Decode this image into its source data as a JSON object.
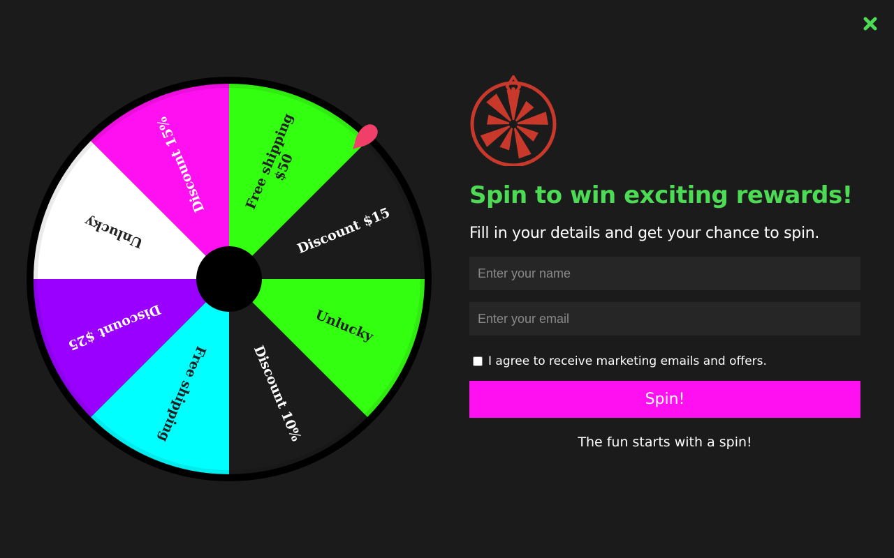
{
  "popup": {
    "close_label": "✖",
    "headline": "Spin to win exciting rewards!",
    "subheadline": "Fill in your details and get your chance to spin.",
    "name_placeholder": "Enter your name",
    "email_placeholder": "Enter your email",
    "consent_label": "I agree to receive marketing emails and offers.",
    "spin_label": "Spin!",
    "tagline": "The fun starts with a spin!"
  },
  "wheel": {
    "segments": [
      {
        "label": "Free shipping $50",
        "color": "#33ff11",
        "text_color": "#222222"
      },
      {
        "label": "Discount $15",
        "color": "#1c1b1b",
        "text_color": "#ffffff"
      },
      {
        "label": "Unlucky",
        "color": "#33ff11",
        "text_color": "#222222"
      },
      {
        "label": "Discount 10%",
        "color": "#1c1b1b",
        "text_color": "#ffffff"
      },
      {
        "label": "Free shipping",
        "color": "#00ffff",
        "text_color": "#222222"
      },
      {
        "label": "Discount $25",
        "color": "#9900ff",
        "text_color": "#ffffff"
      },
      {
        "label": "Unlucky",
        "color": "#ffffff",
        "text_color": "#222222"
      },
      {
        "label": "Discount 15%",
        "color": "#ff10f0",
        "text_color": "#ffffff"
      }
    ],
    "hub_color": "#000000",
    "pointer_color": "#f0406a"
  },
  "colors": {
    "accent_green": "#4ddb56",
    "button_magenta": "#ff10f0",
    "logo_red": "#c9392b",
    "background": "#1c1b1b"
  },
  "icons": {
    "close": "close-icon",
    "logo": "wheel-logo-icon",
    "pointer": "pointer-icon"
  }
}
